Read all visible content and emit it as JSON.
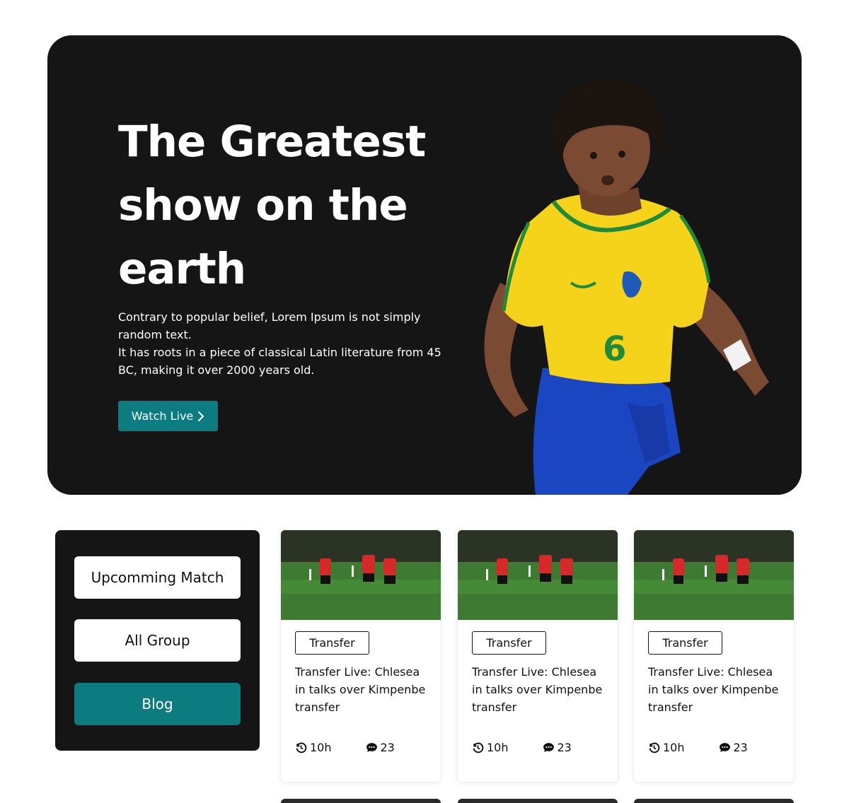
{
  "hero": {
    "title": "The Greatest show on the earth",
    "description_line1": "Contrary to popular belief, Lorem Ipsum is not simply random text.",
    "description_line2": "It has roots in a piece of classical Latin literature from 45 BC, making it over 2000 years old.",
    "watch_button_label": "Watch Live",
    "jersey_number": "6",
    "background_color": "#151515",
    "accent_color": "#0c7c80"
  },
  "sidebar": {
    "items": [
      {
        "label": "Upcomming Match",
        "active": false
      },
      {
        "label": "All Group",
        "active": false
      },
      {
        "label": "Blog",
        "active": true
      }
    ]
  },
  "cards": [
    {
      "tag": "Transfer",
      "title": "Transfer Live: Chlesea in talks over Kimpenbe transfer",
      "time": "10h",
      "comments": "23",
      "time_icon": "history-icon",
      "comments_icon": "comment-dots-icon"
    },
    {
      "tag": "Transfer",
      "title": "Transfer Live: Chlesea in talks over Kimpenbe transfer",
      "time": "10h",
      "comments": "23",
      "time_icon": "history-icon",
      "comments_icon": "comment-dots-icon"
    },
    {
      "tag": "Transfer",
      "title": "Transfer Live: Chlesea in talks over Kimpenbe transfer",
      "time": "10h",
      "comments": "23",
      "time_icon": "history-icon",
      "comments_icon": "comment-dots-icon"
    }
  ]
}
